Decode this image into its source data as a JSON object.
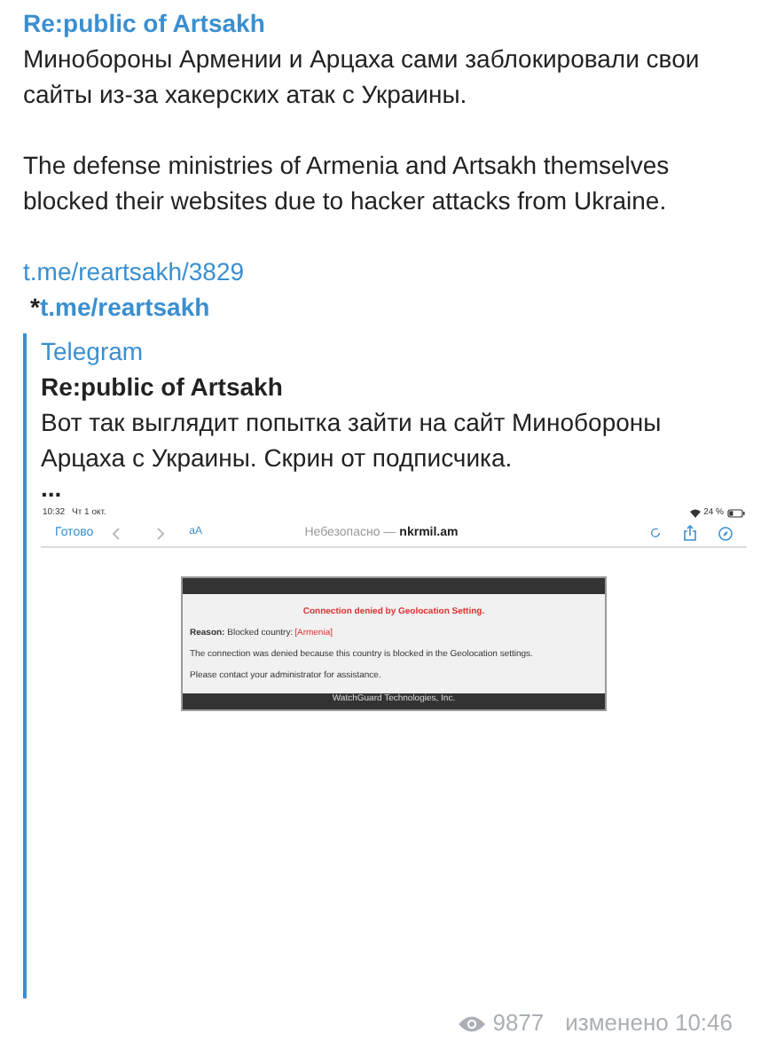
{
  "post": {
    "channel": "Re:public of Artsakh",
    "paragraphs": [
      "Минобороны Армении и Арцаха сами заблокировали свои сайты из-за хакерских атак с Украины.",
      "The defense ministries of Armenia and Artsakh themselves blocked their websites due to hacker attacks from Ukraine."
    ],
    "link": "t.me/reartsakh/3829",
    "star": "*",
    "star_link": "t.me/reartsakh"
  },
  "quote": {
    "source": "Telegram",
    "channel": "Re:public of Artsakh",
    "text": "Вот так выглядит попытка зайти на сайт Минобороны Арцаха с Украины. Скрин от подписчика.",
    "ellipsis": "...",
    "screenshot": {
      "time": "10:32",
      "date": "Чт 1 окт.",
      "battery": "24 %",
      "done": "Готово",
      "text_size": "аА",
      "insecure": "Небезопасно —",
      "domain": "nkrmil.am",
      "error": {
        "title": "Connection denied by Geolocation Setting.",
        "reason": "**Reason:** Blocked country:",
        "country": "[Armenia]",
        "message": "The connection was denied because this country is blocked in the Geolocation settings.",
        "contact": "Please contact your administrator for assistance.",
        "footer": "WatchGuard Technologies, Inc."
      }
    }
  },
  "footer": {
    "views": "9877",
    "edited": "изменено 10:46"
  }
}
